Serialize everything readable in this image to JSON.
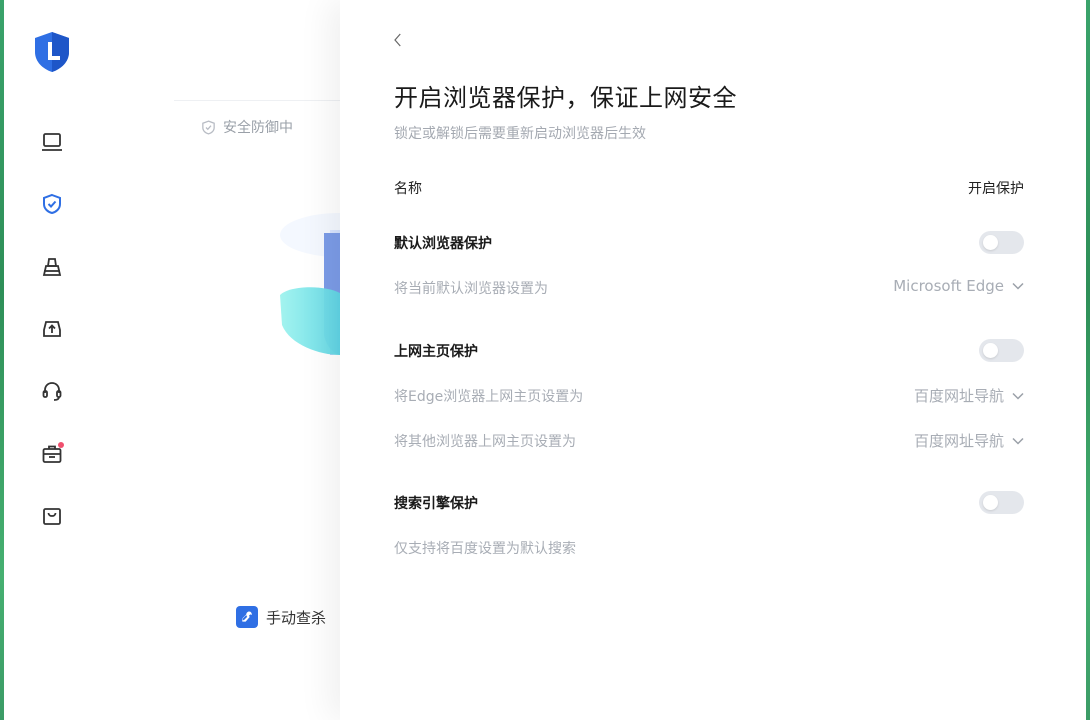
{
  "sidebar": {
    "logo": "lock-shield-logo",
    "items": [
      {
        "icon": "laptop-icon",
        "active": false
      },
      {
        "icon": "shield-check-icon",
        "active": true
      },
      {
        "icon": "broom-icon",
        "active": false
      },
      {
        "icon": "upload-drive-icon",
        "active": false
      },
      {
        "icon": "headset-icon",
        "active": false
      },
      {
        "icon": "toolbox-icon",
        "active": false,
        "badge": true
      },
      {
        "icon": "shopping-bag-icon",
        "active": false
      }
    ],
    "accent_color": "#2f6fe4",
    "icon_color": "#333333"
  },
  "background": {
    "status_label": "安全防御中",
    "manual_scan_label": "手动查杀"
  },
  "panel": {
    "title": "开启浏览器保护，保证上网安全",
    "subtitle": "锁定或解锁后需要重新启动浏览器后生效",
    "header_name": "名称",
    "header_toggle": "开启保护",
    "sections": [
      {
        "title": "默认浏览器保护",
        "enabled": false,
        "rows": [
          {
            "label": "将当前默认浏览器设置为",
            "value": "Microsoft Edge"
          }
        ]
      },
      {
        "title": "上网主页保护",
        "enabled": false,
        "rows": [
          {
            "label": "将Edge浏览器上网主页设置为",
            "value": "百度网址导航"
          },
          {
            "label": "将其他浏览器上网主页设置为",
            "value": "百度网址导航"
          }
        ]
      },
      {
        "title": "搜索引擎保护",
        "enabled": false,
        "rows": [
          {
            "label": "仅支持将百度设置为默认搜索"
          }
        ]
      }
    ]
  }
}
